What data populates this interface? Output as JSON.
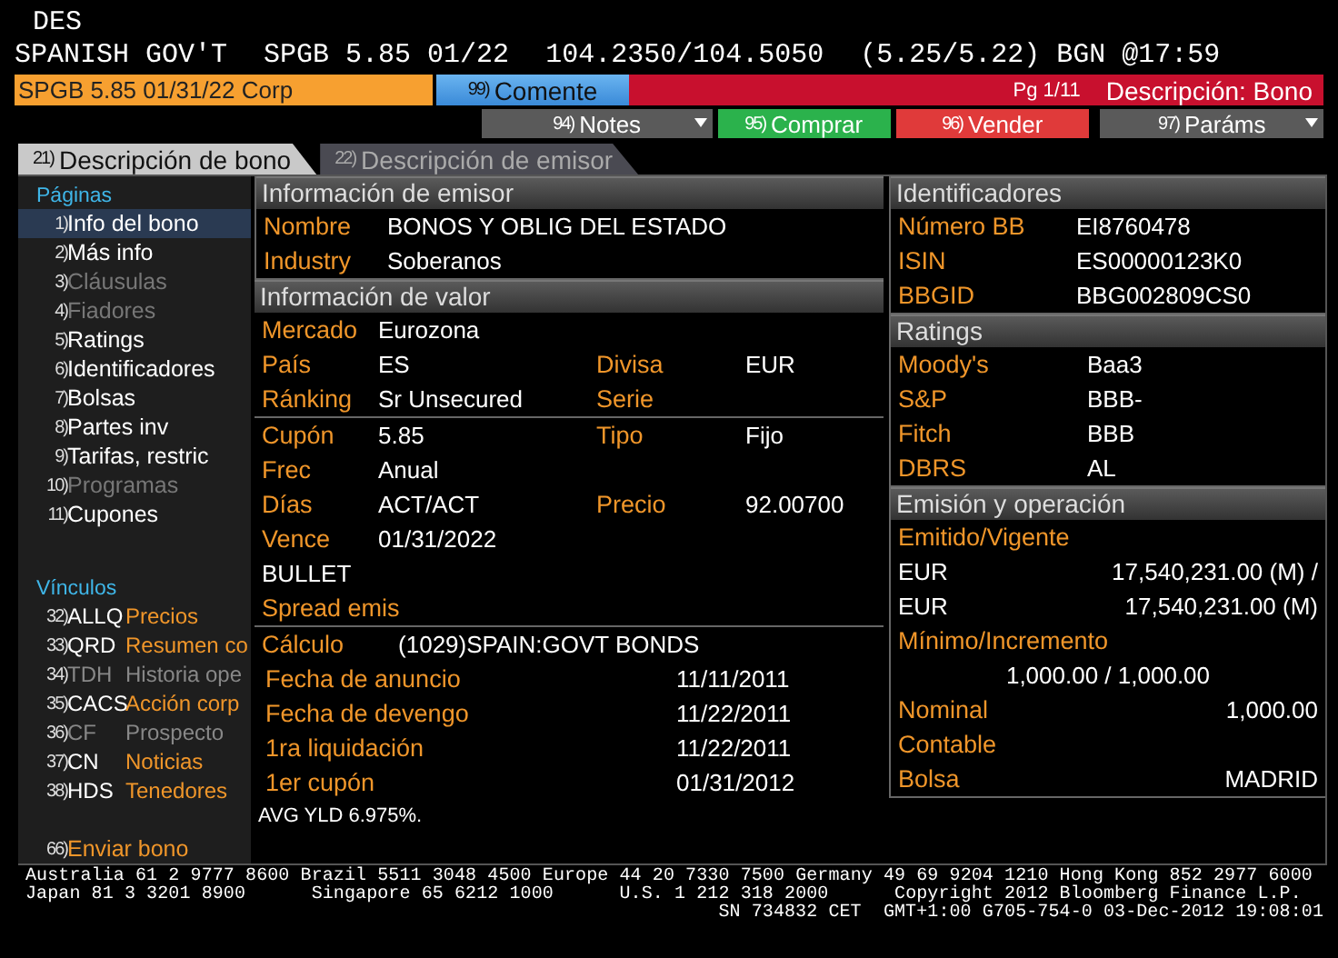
{
  "function": "DES",
  "quote": {
    "name": "SPANISH GOV'T",
    "ticker": "SPGB 5.85 01/22",
    "price": "104.2350/104.5050",
    "yield": "(5.25/5.22)",
    "source": "BGN",
    "time": "@17:59"
  },
  "security_field": "SPGB 5.85 01/31/22 Corp",
  "comment_button": {
    "number": "99)",
    "label": "Comente"
  },
  "page": "Pg 1/11",
  "screen_title": "Descripción: Bono",
  "actions": [
    {
      "number": "94)",
      "label": "Notes",
      "kind": "menu",
      "color": "#5a5a5a"
    },
    {
      "number": "95)",
      "label": "Comprar",
      "kind": "button",
      "color": "#2bb24c"
    },
    {
      "number": "96)",
      "label": "Vender",
      "kind": "button",
      "color": "#e03a3a"
    },
    {
      "number": "97)",
      "label": "Paráms",
      "kind": "menu",
      "color": "#5a5a5a"
    }
  ],
  "tabs": [
    {
      "number": "21)",
      "label": "Descripción de bono",
      "selected": true
    },
    {
      "number": "22)",
      "label": "Descripción de emisor",
      "selected": false
    }
  ],
  "sidebar": {
    "pages_title": "Páginas",
    "pages": [
      {
        "number": "1)",
        "label": "Info del bono",
        "selected": true,
        "disabled": false
      },
      {
        "number": "2)",
        "label": "Más info",
        "selected": false,
        "disabled": false
      },
      {
        "number": "3)",
        "label": "Cláusulas",
        "selected": false,
        "disabled": true
      },
      {
        "number": "4)",
        "label": "Fiadores",
        "selected": false,
        "disabled": true
      },
      {
        "number": "5)",
        "label": "Ratings",
        "selected": false,
        "disabled": false
      },
      {
        "number": "6)",
        "label": "Identificadores",
        "selected": false,
        "disabled": false
      },
      {
        "number": "7)",
        "label": "Bolsas",
        "selected": false,
        "disabled": false
      },
      {
        "number": "8)",
        "label": "Partes inv",
        "selected": false,
        "disabled": false
      },
      {
        "number": "9)",
        "label": "Tarifas, restric",
        "selected": false,
        "disabled": false
      },
      {
        "number": "10)",
        "label": "Programas",
        "selected": false,
        "disabled": true
      },
      {
        "number": "11)",
        "label": "Cupones",
        "selected": false,
        "disabled": false
      }
    ],
    "links_title": "Vínculos",
    "links": [
      {
        "number": "32)",
        "code": "ALLQ",
        "label": "Precios",
        "disabled": false
      },
      {
        "number": "33)",
        "code": "QRD",
        "label": "Resumen co",
        "disabled": false
      },
      {
        "number": "34)",
        "code": "TDH",
        "label": "Historia ope",
        "disabled": true
      },
      {
        "number": "35)",
        "code": "CACS",
        "label": "Acción corp",
        "disabled": false
      },
      {
        "number": "36)",
        "code": "CF",
        "label": "Prospecto",
        "disabled": true
      },
      {
        "number": "37)",
        "code": "CN",
        "label": "Noticias",
        "disabled": false
      },
      {
        "number": "38)",
        "code": "HDS",
        "label": "Tenedores",
        "disabled": false
      }
    ],
    "send": {
      "number": "66)",
      "label": "Enviar bono"
    }
  },
  "issuer_info": {
    "title": "Información de emisor",
    "rows": [
      {
        "label": "Nombre",
        "value": "BONOS Y OBLIG DEL ESTADO"
      },
      {
        "label": "Industry",
        "value": "Soberanos"
      }
    ]
  },
  "security_info": {
    "title": "Información de valor",
    "groups": [
      [
        {
          "cells": [
            {
              "kind": "label",
              "text": "Mercado"
            },
            {
              "kind": "value",
              "text": "Eurozona"
            }
          ]
        },
        {
          "cells": [
            {
              "kind": "label",
              "text": "País"
            },
            {
              "kind": "value",
              "text": "ES"
            },
            {
              "kind": "label",
              "text": "Divisa"
            },
            {
              "kind": "value",
              "text": "EUR"
            }
          ]
        },
        {
          "cells": [
            {
              "kind": "label",
              "text": "Ránking"
            },
            {
              "kind": "value",
              "text": "Sr Unsecured"
            },
            {
              "kind": "label",
              "text": "Serie"
            }
          ]
        }
      ],
      [
        {
          "cells": [
            {
              "kind": "label",
              "text": "Cupón"
            },
            {
              "kind": "value",
              "text": "5.85"
            },
            {
              "kind": "label",
              "text": "Tipo"
            },
            {
              "kind": "value",
              "text": "Fijo"
            }
          ]
        },
        {
          "cells": [
            {
              "kind": "label",
              "text": "Frec"
            },
            {
              "kind": "value",
              "text": "Anual"
            }
          ]
        },
        {
          "cells": [
            {
              "kind": "label",
              "text": "Días"
            },
            {
              "kind": "value",
              "text": "ACT/ACT"
            },
            {
              "kind": "label",
              "text": "Precio"
            },
            {
              "kind": "value",
              "text": "92.00700"
            }
          ]
        },
        {
          "cells": [
            {
              "kind": "label",
              "text": "Vence"
            },
            {
              "kind": "value",
              "text": "01/31/2022"
            }
          ]
        },
        {
          "cells": [
            {
              "kind": "value",
              "text": "BULLET"
            }
          ]
        },
        {
          "cells": [
            {
              "kind": "label",
              "text": "Spread emis"
            }
          ]
        }
      ]
    ]
  },
  "calculation": {
    "label": "Cálculo",
    "value": "(1029)SPAIN:GOVT BONDS",
    "dates": [
      {
        "label": "Fecha de anuncio",
        "value": "11/11/2011"
      },
      {
        "label": "Fecha de devengo",
        "value": "11/22/2011"
      },
      {
        "label": "1ra liquidación",
        "value": "11/22/2011"
      },
      {
        "label": "1er cupón",
        "value": "01/31/2012"
      }
    ]
  },
  "note": "AVG YLD 6.975%.",
  "identifiers": {
    "title": "Identificadores",
    "rows": [
      {
        "label": "Número BB",
        "value": "EI8760478"
      },
      {
        "label": "ISIN",
        "value": "ES00000123K0"
      },
      {
        "label": "BBGID",
        "value": "BBG002809CS0"
      }
    ]
  },
  "ratings": {
    "title": "Ratings",
    "rows": [
      {
        "label": "Moody's",
        "value": "Baa3"
      },
      {
        "label": "S&P",
        "value": "BBB-"
      },
      {
        "label": "Fitch",
        "value": "BBB"
      },
      {
        "label": "DBRS",
        "value": "AL"
      }
    ]
  },
  "issuance": {
    "title": "Emisión y operación",
    "lines": [
      {
        "kind": "heading",
        "label": "Emitido/Vigente"
      },
      {
        "kind": "amount",
        "label": "EUR",
        "value": "17,540,231.00 (M) /"
      },
      {
        "kind": "amount",
        "label": "EUR",
        "value": "17,540,231.00 (M)"
      },
      {
        "kind": "heading",
        "label": "Mínimo/Incremento"
      },
      {
        "kind": "center",
        "value": "1,000.00 / 1,000.00"
      },
      {
        "kind": "pair",
        "label": "Nominal",
        "value": "1,000.00"
      },
      {
        "kind": "heading",
        "label": "Contable"
      },
      {
        "kind": "pair",
        "label": "Bolsa",
        "value": "MADRID"
      }
    ]
  },
  "footer": [
    "Australia 61 2 9777 8600 Brazil 5511 3048 4500 Europe 44 20 7330 7500 Germany 49 69 9204 1210 Hong Kong 852 2977 6000",
    "Japan 81 3 3201 8900      Singapore 65 6212 1000      U.S. 1 212 318 2000      Copyright 2012 Bloomberg Finance L.P.",
    "SN 734832 CET  GMT+1:00 G705-754-0 03-Dec-2012 19:08:01"
  ]
}
